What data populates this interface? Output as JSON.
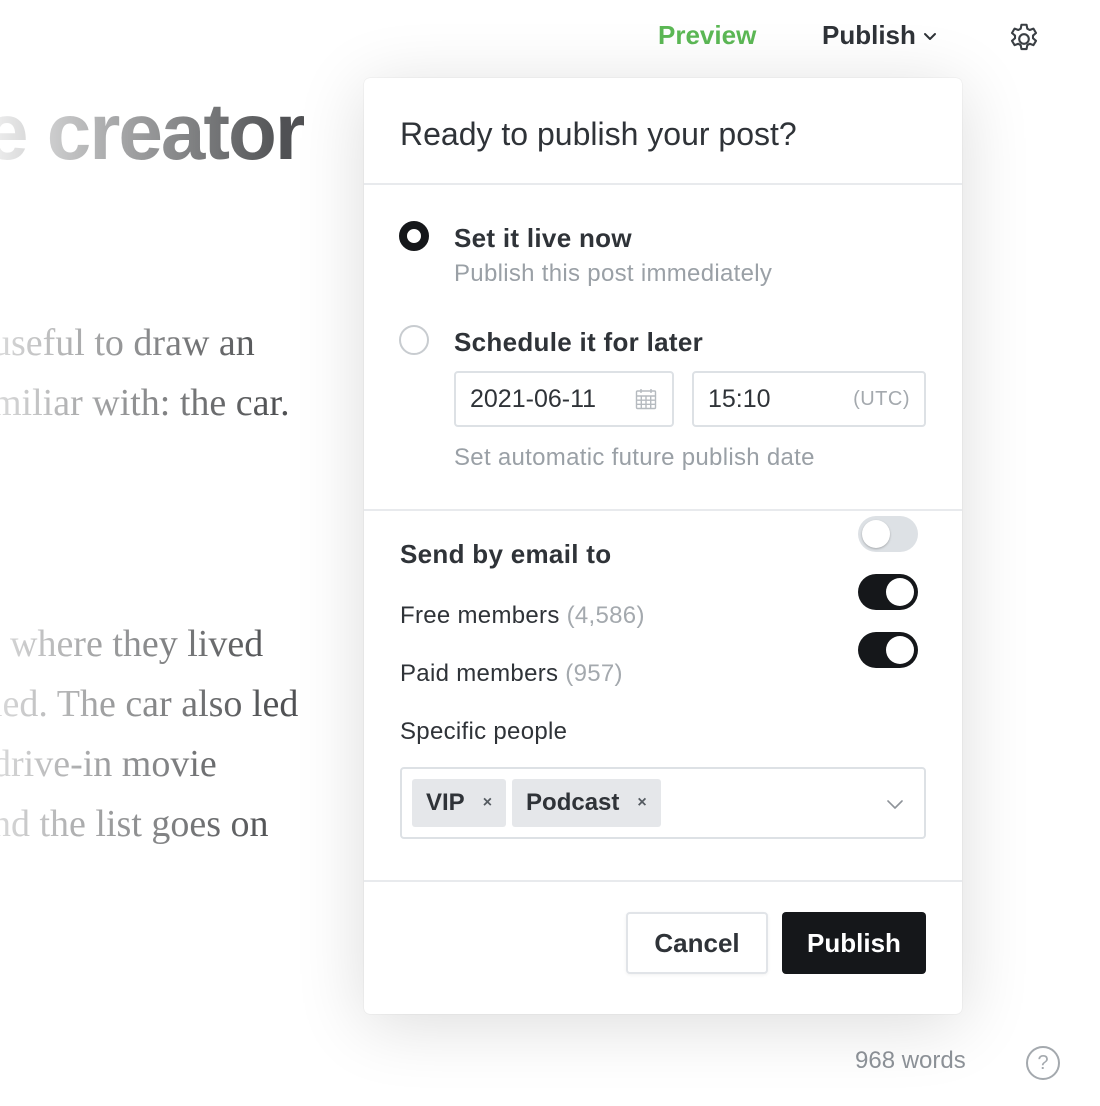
{
  "topbar": {
    "preview_label": "Preview",
    "publish_label": "Publish",
    "preview_color": "#5cb855"
  },
  "editor": {
    "title_fragment": "e creator",
    "para1": [
      "useful to draw an",
      "miliar with: the car."
    ],
    "para2": [
      "where they lived",
      "led. The car also led",
      "drive-in movie",
      "nd the list goes on"
    ]
  },
  "modal": {
    "title": "Ready to publish your post?",
    "options": [
      {
        "label": "Set it live now",
        "description": "Publish this post immediately",
        "selected": true
      },
      {
        "label": "Schedule it for later",
        "description": "Set automatic future publish date",
        "selected": false
      }
    ],
    "schedule": {
      "date": "2021-06-11",
      "time": "15:10",
      "timezone": "(UTC)"
    },
    "email": {
      "title": "Send by email to",
      "rows": [
        {
          "label": "Free members",
          "count": "(4,586)",
          "enabled": false
        },
        {
          "label": "Paid members",
          "count": "(957)",
          "enabled": true
        },
        {
          "label": "Specific people",
          "count": "",
          "enabled": true
        }
      ],
      "tags": [
        "VIP",
        "Podcast"
      ],
      "tag_remove": "×"
    },
    "buttons": {
      "cancel": "Cancel",
      "publish": "Publish"
    }
  },
  "footer": {
    "word_count": "968 words",
    "help": "?"
  },
  "colors": {
    "accent": "#15171a",
    "preview_green": "#5cb855",
    "muted": "#9aa0a6"
  }
}
